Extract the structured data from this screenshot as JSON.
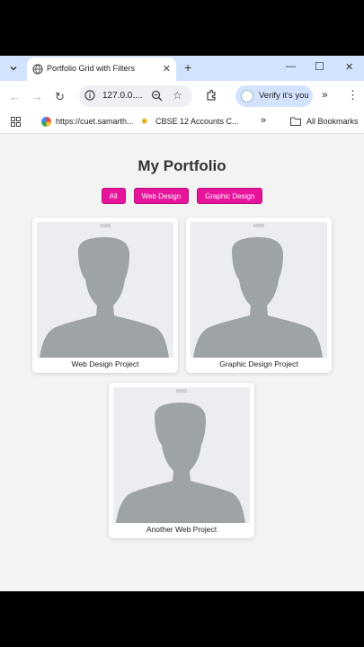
{
  "browser": {
    "tab_title": "Portfolio Grid with Filters",
    "url": "127.0.0....",
    "verify_label": "Verify it's you",
    "bookmarks": [
      "https://cuet.samarth...",
      "CBSE 12 Accounts C...",
      "All Bookmarks"
    ]
  },
  "page": {
    "title": "My Portfolio",
    "filters": [
      "All",
      "Web Design",
      "Graphic Design"
    ],
    "projects": [
      {
        "caption": "Web Design Project"
      },
      {
        "caption": "Graphic Design Project"
      },
      {
        "caption": "Another Web Project"
      }
    ]
  },
  "colors": {
    "accent": "#e7139b",
    "tabstrip": "#d3e3fd",
    "page_bg": "#f3f3f3",
    "placeholder": "#9ea3a5"
  }
}
